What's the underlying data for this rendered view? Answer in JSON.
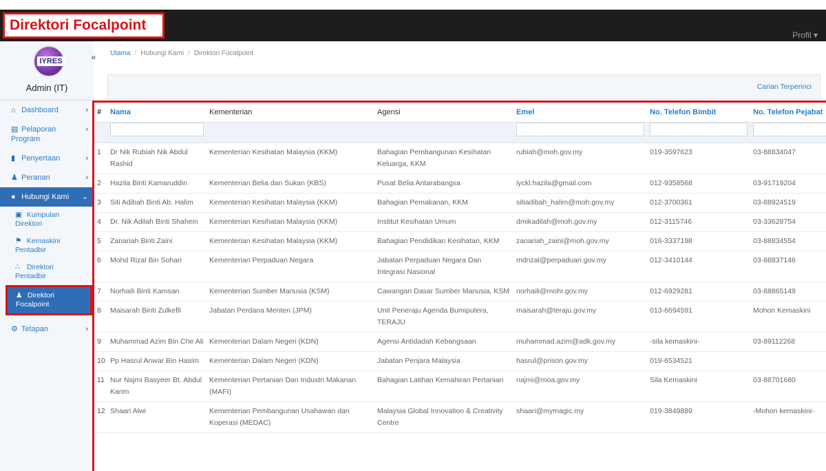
{
  "app": {
    "title": "Direktori Focalpoint",
    "profile_label": "Profil ▾"
  },
  "sidebar": {
    "logo_text": "IYRES",
    "user": "Admin (IT)",
    "collapse_icon": "«",
    "items": [
      {
        "label": "Dashboard",
        "icon": "home-icon"
      },
      {
        "label": "Pelaporan Program",
        "icon": "file-icon"
      },
      {
        "label": "Penyertaan",
        "icon": "book-icon"
      },
      {
        "label": "Peranan",
        "icon": "user-icon"
      },
      {
        "label": "Hubungi Kami",
        "icon": "chat-icon"
      },
      {
        "label": "Tetapan",
        "icon": "gear-icon"
      }
    ],
    "subitems": [
      {
        "label": "Kumpulan Direktori",
        "icon": "group-icon"
      },
      {
        "label": "Kemaskini Pentadbir",
        "icon": "users-icon"
      },
      {
        "label": "Direktori Pentadbir",
        "icon": "sitemap-icon"
      },
      {
        "label": "Direktori Focalpoint",
        "icon": "user-icon"
      }
    ]
  },
  "breadcrumb": {
    "home": "Utama",
    "middle": "Hubungi Kami",
    "current": "Direktori Focalpoint",
    "separator": "/"
  },
  "toolbar": {
    "advanced_search": "Carian Terperinci"
  },
  "table": {
    "headers": {
      "num": "#",
      "nama": "Nama",
      "kementerian": "Kementerian",
      "agensi": "Agensi",
      "emel": "Emel",
      "bimbit": "No. Telefon Bimbit",
      "pejabat": "No. Telefon Pejabat"
    },
    "rows": [
      {
        "num": "1",
        "nama": "Dr Nik Rubiah Nik Abdul Rashid",
        "kementerian": "Kementerian Kesihatan Malaysia (KKM)",
        "agensi": "Bahagian Pembangunan Kesihatan Keluarga, KKM",
        "emel": "rubiah@moh.gov.my",
        "bimbit": "019-3597623",
        "pejabat": "03-88834047"
      },
      {
        "num": "2",
        "nama": "Hazila Binti Kamaruddin",
        "kementerian": "Kementerian Belia dan Sukan (KBS)",
        "agensi": "Pusat Belia Antarabangsa",
        "emel": "iyckl.hazila@gmail.com",
        "bimbit": "012-9358568",
        "pejabat": "03-91719204"
      },
      {
        "num": "3",
        "nama": "Siti Adibah Binti Ab. Halim",
        "kementerian": "Kementerian Kesihatan Malaysia (KKM)",
        "agensi": "Bahagian Pemakanan, KKM",
        "emel": "sitiadibah_halim@moh.gov.my",
        "bimbit": "012-3700361",
        "pejabat": "03-88924519"
      },
      {
        "num": "4",
        "nama": "Dr. Nik Adilah Binti Shahein",
        "kementerian": "Kementerian Kesihatan Malaysia (KKM)",
        "agensi": "Institut Kesihatan Umum",
        "emel": "dmikadilah@moh.gov.my",
        "bimbit": "012-3115746",
        "pejabat": "03-33628754"
      },
      {
        "num": "5",
        "nama": "Zanariah Binti Zaini",
        "kementerian": "Kementerian Kesihatan Malaysia (KKM)",
        "agensi": "Bahagian Pendidikan Kesihatan, KKM",
        "emel": "zanariah_zaini@moh.gov.my",
        "bimbit": "016-3337198",
        "pejabat": "03-88834554"
      },
      {
        "num": "6",
        "nama": "Mohd Rizal Bin Sohari",
        "kementerian": "Kementerian Perpaduan Negara",
        "agensi": "Jabatan Perpaduan Negara Dan Integrasi Nasional",
        "emel": "mdrizal@perpaduan.gov.my",
        "bimbit": "012-3410144",
        "pejabat": "03-88837146"
      },
      {
        "num": "7",
        "nama": "Norhaili Binti Kamsan",
        "kementerian": "Kementerian Sumber Manusia (KSM)",
        "agensi": "Cawangan Dasar Sumber Manusia, KSM",
        "emel": "norhaili@mohr.gov.my",
        "bimbit": "012-6929281",
        "pejabat": "03-88865149"
      },
      {
        "num": "8",
        "nama": "Maisarah Binti Zulkefli",
        "kementerian": "Jabatan Perdana Menteri (JPM)",
        "agensi": "Unit Peneraju Agenda Bumiputera, TERAJU",
        "emel": "maisarah@teraju.gov.my",
        "bimbit": "013-6694591",
        "pejabat": "Mohon Kemaskini"
      },
      {
        "num": "9",
        "nama": "Muhammad Azim Bin Che Ali",
        "kementerian": "Kementerian Dalam Negeri (KDN)",
        "agensi": "Agensi Antidadah Kebangsaan",
        "emel": "muhammad.azim@adk.gov.my",
        "bimbit": "-sila kemaskini-",
        "pejabat": "03-89112268"
      },
      {
        "num": "10",
        "nama": "Pp Hasrul Anwar Bin Hasim",
        "kementerian": "Kementerian Dalam Negeri (KDN)",
        "agensi": "Jabatan Penjara Malaysia",
        "emel": "hasrul@prison.gov.my",
        "bimbit": "019-6534521",
        "pejabat": ""
      },
      {
        "num": "11",
        "nama": "Nur Najmi Basyeer Bt. Abdul Karim",
        "kementerian": "Kementerian Pertanian Dan Industri Makanan (MAFI)",
        "agensi": "Bahagian Latihan Kemahiran Pertanian",
        "emel": "najmi@moa.gov.my",
        "bimbit": "Sila Kemaskini",
        "pejabat": "03-88701680"
      },
      {
        "num": "12",
        "nama": "Shaari Alwi",
        "kementerian": "Kementerian Pembangunan Usahawan dan Koperasi (MEDAC)",
        "agensi": "Malaysia Global Innovation & Creativity Centre",
        "emel": "shaari@mymagic.my",
        "bimbit": "019-3849889",
        "pejabat": "-Mohon kemaskini-"
      }
    ]
  }
}
